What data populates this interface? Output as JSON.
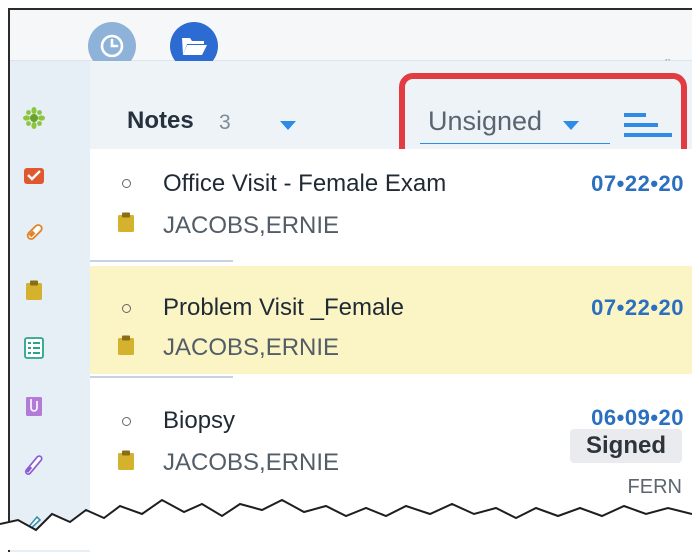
{
  "toolbar": {
    "clock_icon": "clock-icon",
    "folder_icon": "folder-open-icon"
  },
  "sidebar": {
    "icons": [
      "star-flower-icon",
      "inbox-icon",
      "pill-icon",
      "clipboard-icon",
      "list-icon",
      "document-clip-icon",
      "test-tube-icon",
      "pencil-icon"
    ]
  },
  "header": {
    "title": "Notes",
    "count": "3",
    "filter_value": "Unsigned"
  },
  "notes": [
    {
      "title": "Office Visit - Female Exam",
      "author": "JACOBS,ERNIE",
      "date": "07•22•20"
    },
    {
      "title": "Problem Visit _Female",
      "author": "JACOBS,ERNIE",
      "date": "07•22•20"
    },
    {
      "title": "Biopsy",
      "author": "JACOBS,ERNIE",
      "date": "06•09•20",
      "status": "Signed",
      "signer": "FERN"
    }
  ],
  "colors": {
    "accent": "#2f8be6",
    "highlight_border": "#e23b41",
    "selected_row": "#fbf5c6",
    "date_text": "#2a6fc0"
  }
}
